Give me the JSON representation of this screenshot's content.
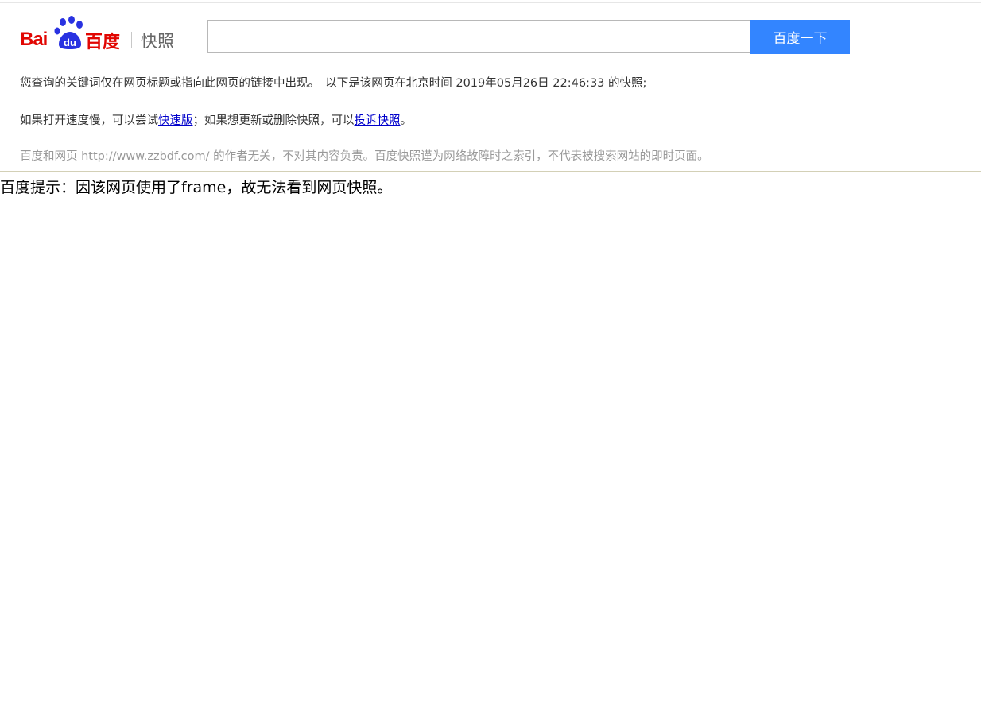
{
  "logo": {
    "brand_latin": "Bai",
    "brand_paw_text": "du",
    "brand_cn": "百度",
    "product": "快照",
    "colors": {
      "red": "#e10602",
      "blue": "#2932e1"
    }
  },
  "search": {
    "value": "",
    "button_label": "百度一下",
    "button_color": "#3385ff"
  },
  "info": {
    "line1": "您查询的关键词仅在网页标题或指向此网页的链接中出现。　以下是该网页在北京时间 2019年05月26日 22:46:33 的快照;",
    "line2_prefix": "如果打开速度慢，可以尝试",
    "line2_link1": "快速版",
    "line2_middle": "；如果想更新或删除快照，可以",
    "line2_link2": "投诉快照",
    "line2_suffix": "。",
    "line3_prefix": "百度和网页 ",
    "line3_url": "http://www.zzbdf.com/",
    "line3_suffix": " 的作者无关，不对其内容负责。百度快照谨为网络故障时之索引，不代表被搜索网站的即时页面。"
  },
  "frame_notice": "百度提示：因该网页使用了frame，故无法看到网页快照。"
}
